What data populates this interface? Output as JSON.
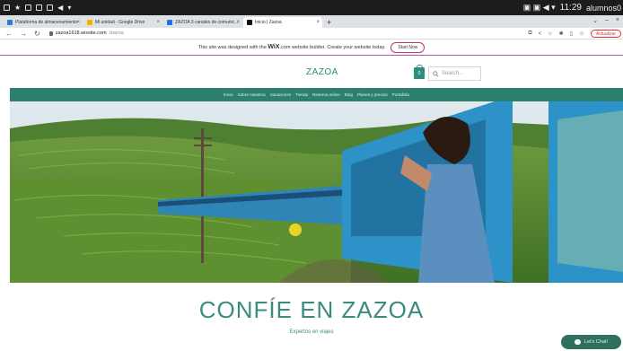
{
  "system": {
    "clock": "11:29",
    "user": "alumnos0"
  },
  "tabs": [
    {
      "title": "Plataforma de almacenamiento",
      "favicon_color": "#2a7fd4",
      "active": false
    },
    {
      "title": "Mi unidad - Google Drive",
      "favicon_color": "#f4b400",
      "active": false
    },
    {
      "title": "ZAZOA 3 canales de comunic...",
      "favicon_color": "#1a73e8",
      "active": false
    },
    {
      "title": "Inicio | Zazoa",
      "favicon_color": "#111111",
      "active": true
    }
  ],
  "address": {
    "host": "zazoa1618.wixsite.com",
    "path": "/zazoa",
    "update_label": "Actualizar"
  },
  "wix_banner": {
    "pre": "This site was designed with the",
    "brand": "WiX",
    "post": ".com website builder. Create your website today.",
    "button": "Start Now"
  },
  "header": {
    "logo": "ZAZOA",
    "cart_count": "0",
    "search_placeholder": "Search..."
  },
  "nav": [
    "Inicio",
    "Sobre nosotros",
    "Vacaciones",
    "Tienda",
    "Reserva online",
    "Blog",
    "Planes y precios",
    "Portafolio"
  ],
  "hero": {
    "headline": "CONFÍE EN ZAZOA",
    "subheadline": "Expertos en viajes"
  },
  "chat": {
    "label": "Let's Chat!"
  },
  "colors": {
    "brand": "#2d7f6f",
    "accent": "#3a8c7f",
    "wix_purple": "#b44bc8"
  }
}
